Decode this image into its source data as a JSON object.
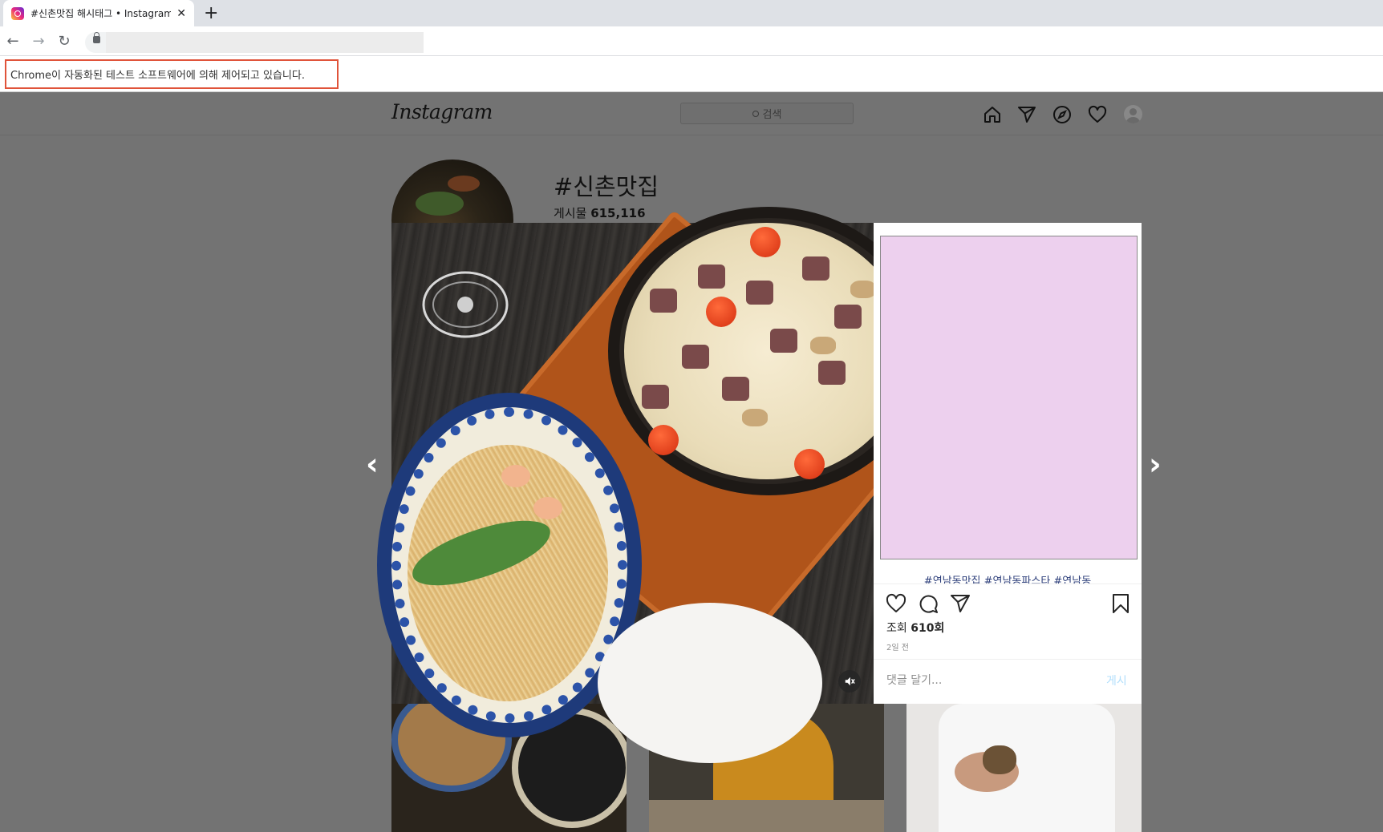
{
  "browser": {
    "tab_title": "#신촌맛집 해시태그 • Instagram",
    "tab_close": "✕",
    "new_tab": "+",
    "back": "←",
    "forward": "→",
    "reload": "↻",
    "infobar_text": "Chrome이 자동화된 테스트 소프트웨어에 의해 제어되고 있습니다."
  },
  "instagram": {
    "logo": "Instagram",
    "search_placeholder": "검색",
    "nav_icons": [
      "home-icon",
      "direct-icon",
      "explore-icon",
      "activity-icon",
      "profile-avatar"
    ],
    "hashtag": "#신촌맛집",
    "post_count_label": "게시물",
    "post_count": "615,116"
  },
  "modal": {
    "prev": "‹",
    "next": "›",
    "caption_tags": "#연남동맛집 #연남동파스타 #연남동",
    "views_prefix": "조회",
    "views_count": "610회",
    "time_ago": "2일 전",
    "comment_placeholder": "댓글 달기...",
    "post_button": "게시",
    "colors": {
      "caption_block": "#edd0ee",
      "post_button": "#b2dffc"
    }
  }
}
